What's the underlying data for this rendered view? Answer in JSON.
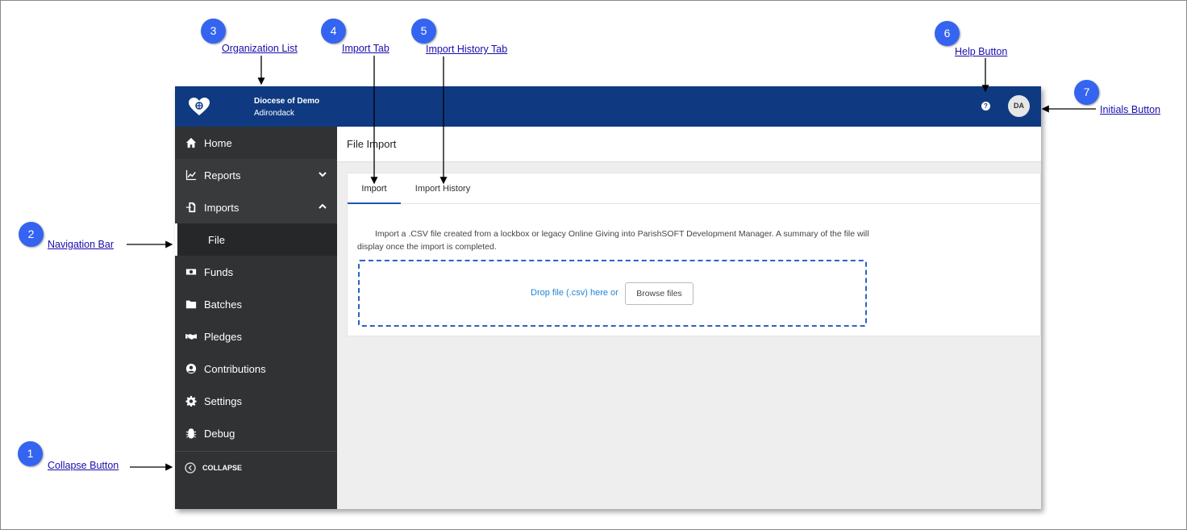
{
  "header": {
    "org_name": "Diocese of Demo",
    "org_sub": "Adirondack",
    "help_label": "?",
    "initials": "DA"
  },
  "sidebar": {
    "items": [
      {
        "label": "Home",
        "icon": "home-icon"
      },
      {
        "label": "Reports",
        "icon": "chart-line-icon",
        "expand": "chevron-down-icon"
      },
      {
        "label": "Imports",
        "icon": "file-import-icon",
        "expand": "chevron-up-icon"
      },
      {
        "label": "File",
        "sub": true
      },
      {
        "label": "Funds",
        "icon": "money-icon"
      },
      {
        "label": "Batches",
        "icon": "folder-icon"
      },
      {
        "label": "Pledges",
        "icon": "handshake-icon"
      },
      {
        "label": "Contributions",
        "icon": "user-circle-icon"
      },
      {
        "label": "Settings",
        "icon": "gear-icon"
      },
      {
        "label": "Debug",
        "icon": "bug-icon"
      }
    ],
    "collapse_label": "COLLAPSE"
  },
  "main": {
    "page_title": "File Import",
    "tabs": [
      {
        "label": "Import",
        "active": true
      },
      {
        "label": "Import History",
        "active": false
      }
    ],
    "description": "Import a .CSV file created from a lockbox or legacy Online Giving into ParishSOFT Development Manager. A summary of the file will display once the import is completed.",
    "drop_text": "Drop file (.csv) here or",
    "browse_label": "Browse files"
  },
  "callouts": [
    {
      "number": "1",
      "label": "Collapse Button"
    },
    {
      "number": "2",
      "label": "Navigation Bar"
    },
    {
      "number": "3",
      "label": "Organization List"
    },
    {
      "number": "4",
      "label": "Import Tab"
    },
    {
      "number": "5",
      "label": "Import History Tab"
    },
    {
      "number": "6",
      "label": "Help Button"
    },
    {
      "number": "7",
      "label": "Initials Button"
    }
  ],
  "colors": {
    "topbar": "#0f3a82",
    "sidebar": "#303233",
    "accent": "#1a56b8",
    "badge": "#3464f0",
    "link": "#1a0dab"
  }
}
